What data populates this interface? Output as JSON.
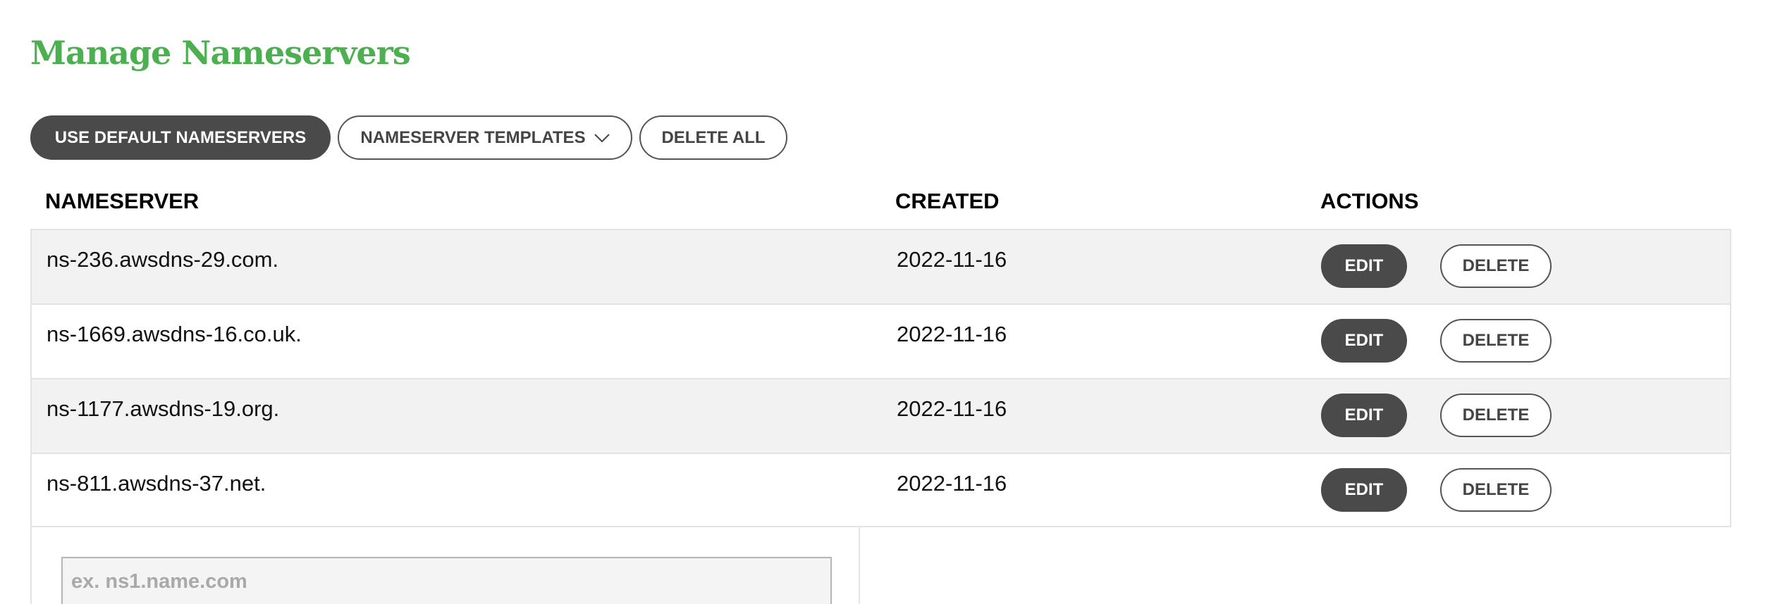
{
  "page": {
    "title": "Manage Nameservers"
  },
  "toolbar": {
    "use_default_label": "USE DEFAULT NAMESERVERS",
    "templates_label": "NAMESERVER TEMPLATES",
    "delete_all_label": "DELETE ALL"
  },
  "table": {
    "headers": {
      "nameserver": "NAMESERVER",
      "created": "CREATED",
      "actions": "ACTIONS"
    },
    "rows": [
      {
        "nameserver": "ns-236.awsdns-29.com.",
        "created": "2022-11-16",
        "edit_label": "EDIT",
        "delete_label": "DELETE"
      },
      {
        "nameserver": "ns-1669.awsdns-16.co.uk.",
        "created": "2022-11-16",
        "edit_label": "EDIT",
        "delete_label": "DELETE"
      },
      {
        "nameserver": "ns-1177.awsdns-19.org.",
        "created": "2022-11-16",
        "edit_label": "EDIT",
        "delete_label": "DELETE"
      },
      {
        "nameserver": "ns-811.awsdns-37.net.",
        "created": "2022-11-16",
        "edit_label": "EDIT",
        "delete_label": "DELETE"
      }
    ]
  },
  "add_form": {
    "nameserver_placeholder": "ex. ns1.name.com",
    "nameserver_value": ""
  },
  "icons": {
    "templates_dropdown": "chevron-down-icon"
  },
  "colors": {
    "title_green": "#4caf50",
    "dark_button": "#4a4a4a",
    "row_shade": "#f2f2f2"
  }
}
